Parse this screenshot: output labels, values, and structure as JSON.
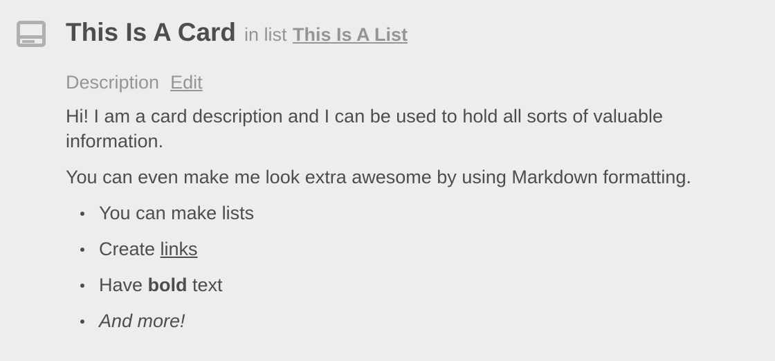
{
  "card": {
    "icon": "card-icon",
    "title": "This Is A Card",
    "in_list_label": "in list",
    "list_name": "This Is A List"
  },
  "description": {
    "label": "Description",
    "edit_label": "Edit",
    "paragraphs": [
      "Hi! I am a card description and I can be used to hold all sorts of valuable information.",
      "You can even make me look extra awesome by using Markdown formatting."
    ],
    "list_items": {
      "item1": "You can make lists",
      "item2_prefix": "Create ",
      "item2_link": "links",
      "item3_prefix": "Have ",
      "item3_bold": "bold",
      "item3_suffix": " text",
      "item4": "And more!"
    }
  },
  "colors": {
    "background": "#ededed",
    "text": "#4d4d4d",
    "muted": "#959595",
    "icon": "#b0b0b0"
  }
}
